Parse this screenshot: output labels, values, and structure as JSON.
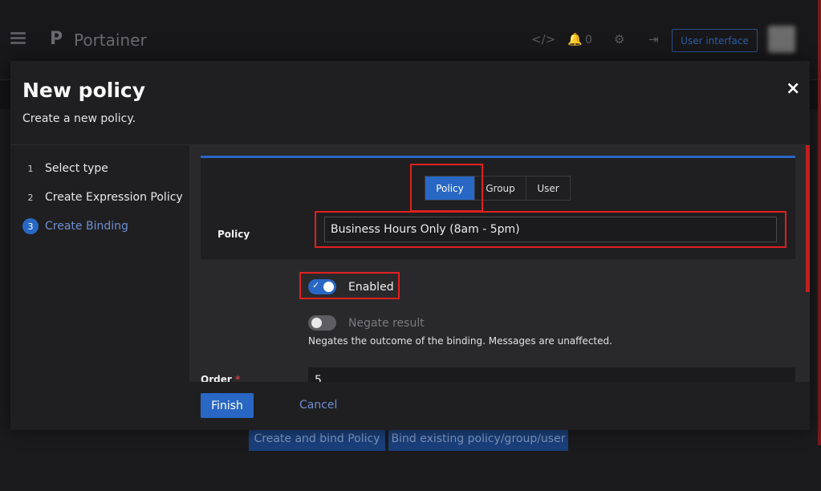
{
  "app": {
    "brand_letter": "P",
    "brand": "Portainer",
    "notifications_count": "0",
    "user_interface_label": "User interface"
  },
  "background": {
    "create_bind_label": "Create and bind Policy",
    "bind_existing_label": "Bind existing policy/group/user"
  },
  "modal": {
    "title": "New policy",
    "subtitle": "Create a new policy.",
    "close_label": "×",
    "steps": [
      {
        "num": "1",
        "label": "Select type"
      },
      {
        "num": "2",
        "label": "Create Expression Policy"
      },
      {
        "num": "3",
        "label": "Create Binding"
      }
    ],
    "binding_type": {
      "options": [
        "Policy",
        "Group",
        "User"
      ],
      "selected": "Policy"
    },
    "policy_label": "Policy",
    "policy_value": "Business Hours Only (8am - 5pm)",
    "enabled_label": "Enabled",
    "negate_label": "Negate result",
    "negate_help": "Negates the outcome of the binding. Messages are unaffected.",
    "order_label": "Order",
    "order_required": "*",
    "order_value": "5",
    "finish_label": "Finish",
    "cancel_label": "Cancel"
  },
  "icons": {
    "menu": "hamburger-icon",
    "code": "code-icon",
    "bell": "bell-icon",
    "gear": "gear-icon",
    "logout": "logout-icon",
    "check": "check-icon",
    "close": "close-icon"
  },
  "colors": {
    "accent": "#2967c4",
    "highlight": "#e02020",
    "link": "#6f8ecf"
  }
}
